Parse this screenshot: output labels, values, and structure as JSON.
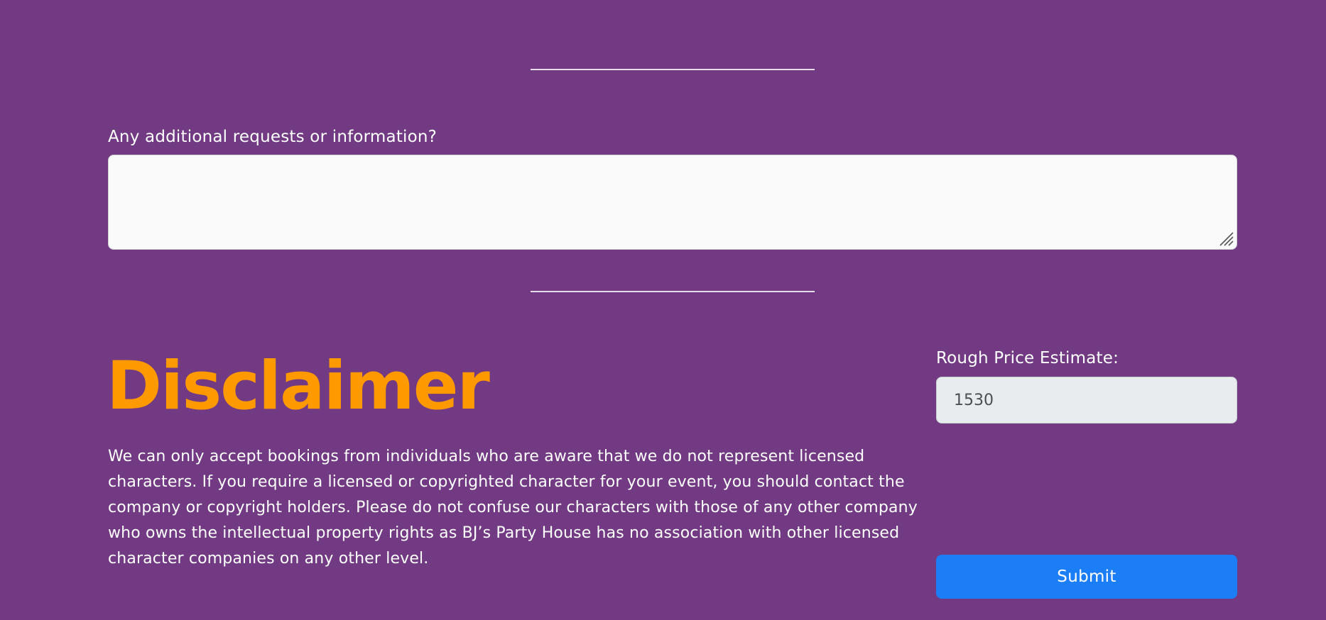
{
  "requests": {
    "label": "Any additional requests or information?",
    "value": ""
  },
  "disclaimer": {
    "title": "Disclaimer",
    "text": "We can only accept bookings from individuals who are aware that we do not represent licensed characters. If you require a licensed or copyrighted character for your event, you should contact the company or copyright holders. Please do not confuse our characters with those of any other company who owns the intellectual property rights as BJ’s Party House has no association with other licensed character companies on any other level."
  },
  "estimate": {
    "label": "Rough Price Estimate:",
    "value": "1530"
  },
  "submit": {
    "label": "Submit"
  },
  "colors": {
    "background": "#713a82",
    "accent": "#ff9900",
    "button": "#1b7ef6",
    "textarea": "#fafafa",
    "readonly_input": "#e9ecef"
  }
}
